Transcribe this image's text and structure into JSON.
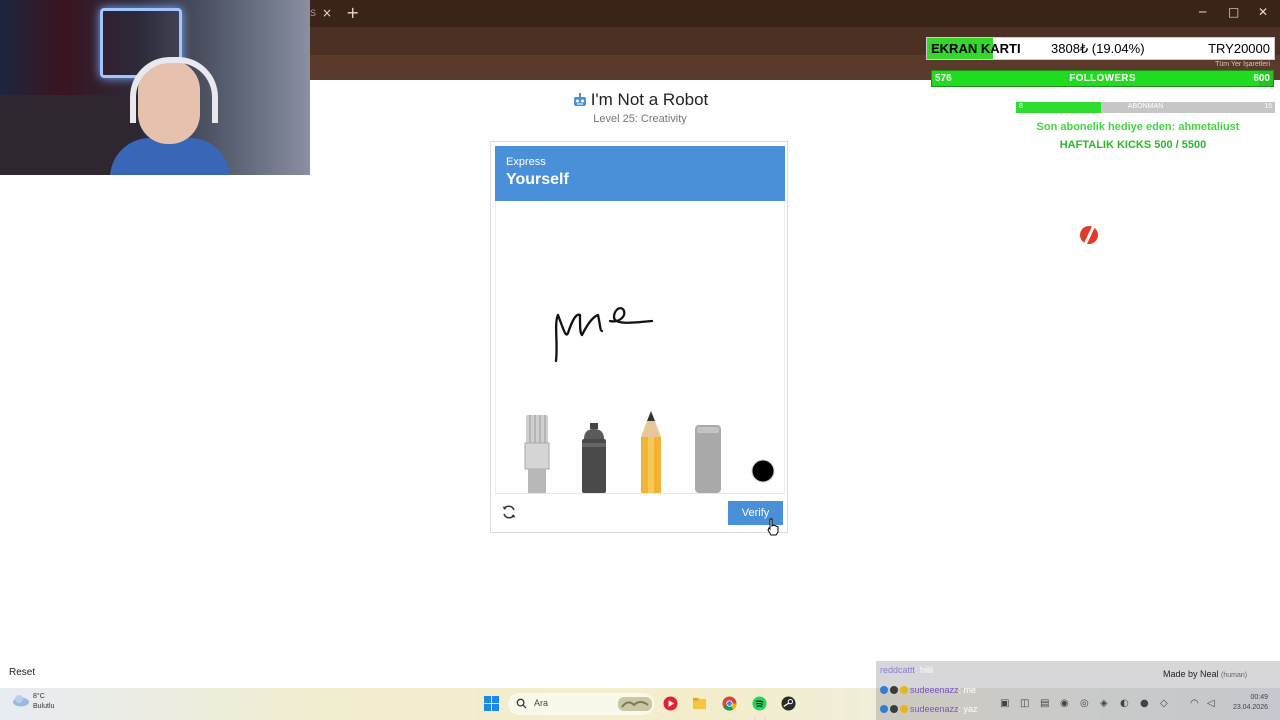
{
  "browser": {
    "tab_close": "×",
    "tab_fragment": "S",
    "new_tab": "+",
    "win_minimize": "─",
    "win_maximize": "□",
    "win_close": "✕",
    "bookmark_folder": "Tüm Yer İşaretleri"
  },
  "captcha": {
    "title": "I'm Not a Robot",
    "level": "Level 25: Creativity",
    "prompt_small": "Express",
    "prompt_big": "Yourself",
    "drawing_text": "Me",
    "tools": [
      "paint-brush",
      "spray-can",
      "pencil",
      "eraser"
    ],
    "selected_color": "#000000",
    "verify_label": "Verify"
  },
  "overlay": {
    "ekran_label": "EKRAN KARTI",
    "ekran_value": "3808₺ (19.04%)",
    "ekran_goal": "TRY20000",
    "ekran_progress": 0.1904,
    "followers_label": "FOLLOWERS",
    "followers_current": "576",
    "followers_goal": "600",
    "followers_progress": 0.96,
    "abone_label": "ABONMAN",
    "abone_current": "8",
    "abone_goal": "15",
    "abone_progress": 0.33,
    "gift_text": "Son abonelik hediye eden: ahmetaliust",
    "kicks_text": "HAFTALIK KICKS 500 / 5500"
  },
  "page": {
    "reset_label": "Reset"
  },
  "taskbar": {
    "weather_temp": "8°C",
    "weather_cond": "Bulutlu",
    "search_placeholder": "Ara",
    "time": "00:49",
    "date": "23.04.2026"
  },
  "chat": {
    "messages": [
      {
        "user": "reddcattt",
        "text": ": hiiii"
      },
      {
        "user": "sudeeenazz",
        "text": ": me"
      },
      {
        "user": "sudeeenazz",
        "text": ": yaz"
      }
    ],
    "made_by": "Made by Neal",
    "made_by_tag": "(human)"
  },
  "colors": {
    "accent": "#4a90d9",
    "overlay_green": "#35d62e",
    "titlebar": "#3a2418"
  }
}
